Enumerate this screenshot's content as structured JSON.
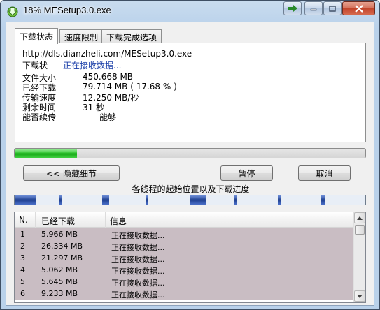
{
  "window": {
    "title": "18% MESetup3.0.exe"
  },
  "tabs": [
    {
      "label": "下载状态",
      "active": true
    },
    {
      "label": "速度限制",
      "active": false
    },
    {
      "label": "下载完成选项",
      "active": false
    }
  ],
  "status": {
    "url": "http://dls.dianzheli.com/MESetup3.0.exe",
    "state_label": "下载状",
    "state_value": "正在接收数据...",
    "file_size_label": "文件大小",
    "file_size_value": "450.668  MB",
    "downloaded_label": "已经下载",
    "downloaded_value": "79.714  MB  ( 17.68 % )",
    "speed_label": "传输速度",
    "speed_value": "12.250  MB/秒",
    "remaining_label": "剩余时间",
    "remaining_value": "31 秒",
    "resume_label": "能否续传",
    "resume_value": "能够"
  },
  "progress": {
    "percent": 17.68
  },
  "buttons": {
    "hide_details": "<< 隐藏细节",
    "pause": "暂停",
    "cancel": "取消"
  },
  "threads_caption": "各线程的起始位置以及下载进度",
  "thread_segments": [
    {
      "start": 0.0,
      "progress": 0.06
    },
    {
      "start": 0.125,
      "progress": 0.01
    },
    {
      "start": 0.25,
      "progress": 0.02
    },
    {
      "start": 0.375,
      "progress": 0.005
    },
    {
      "start": 0.5,
      "progress": 0.045
    },
    {
      "start": 0.625,
      "progress": 0.01
    },
    {
      "start": 0.75,
      "progress": 0.01
    },
    {
      "start": 0.875,
      "progress": 0.01
    }
  ],
  "colors": {
    "progress_fill": "#1fb11f",
    "thread_done": "#1e3f8f",
    "row_bg": "#c9bdc3"
  },
  "list": {
    "columns": [
      "N.",
      "已经下载",
      "信息"
    ],
    "rows": [
      {
        "n": "1",
        "downloaded": "5.966 MB",
        "info": "正在接收数据..."
      },
      {
        "n": "2",
        "downloaded": "26.334 MB",
        "info": "正在接收数据..."
      },
      {
        "n": "3",
        "downloaded": "21.297 MB",
        "info": "正在接收数据..."
      },
      {
        "n": "4",
        "downloaded": "5.062 MB",
        "info": "正在接收数据..."
      },
      {
        "n": "5",
        "downloaded": "5.645 MB",
        "info": "正在接收数据..."
      },
      {
        "n": "6",
        "downloaded": "9.233 MB",
        "info": "正在接收数据..."
      }
    ]
  }
}
